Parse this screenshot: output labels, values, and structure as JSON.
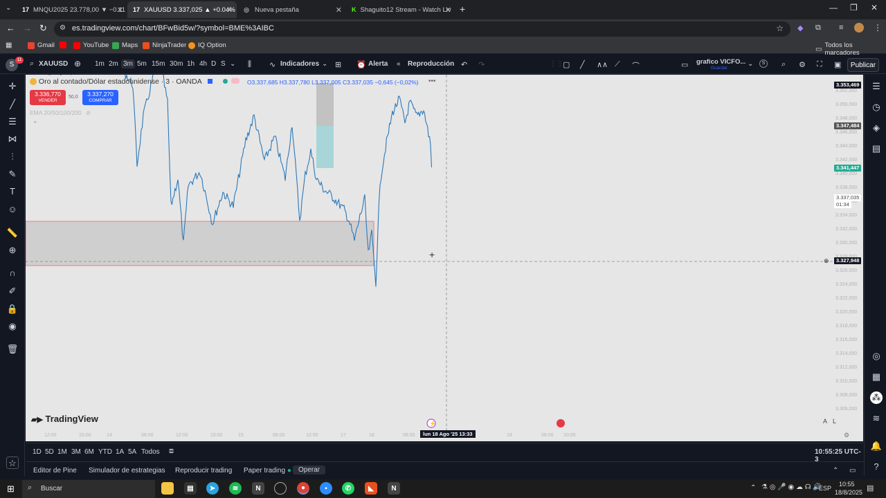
{
  "browser": {
    "tabs": [
      {
        "title": "MNQU2025 23.778,00 ▼ −0.11",
        "active": false
      },
      {
        "title": "XAUUSD 3.337,025 ▲ +0.04% ·",
        "active": true
      },
      {
        "title": "Nueva pestaña",
        "active": false
      },
      {
        "title": "Shaguito12 Stream - Watch Liv",
        "active": false
      }
    ],
    "url": "es.tradingview.com/chart/BFwBid5w/?symbol=BME%3AIBC",
    "bookmarks": [
      "Gmail",
      "YouTube",
      "Maps",
      "NinjaTrader",
      "IQ Option"
    ],
    "all_bookmarks": "Todos los marcadores"
  },
  "toolbar": {
    "avatar_letter": "S",
    "avatar_badge": "11",
    "symbol": "XAUUSD",
    "intervals": [
      "1m",
      "2m",
      "3m",
      "5m",
      "15m",
      "30m",
      "1h",
      "4h",
      "D",
      "S"
    ],
    "selected_interval": "3m",
    "indicators": "Indicadores",
    "alert": "Alerta",
    "replay": "Reproducción",
    "layout_name": "grafico VICFO...",
    "layout_save": "Guardar",
    "layout_s": "S",
    "publish": "Publicar"
  },
  "chart": {
    "legend_title": "Oro al contado/Dólar estadounidense · 3 · OANDA",
    "ohlc": "O3.337,685 H3.337,780 L3.337,005 C3.337,035 −0,645 (−0,02%)",
    "sell_price": "3.336,770",
    "sell_label": "VENDER",
    "buy_price": "3.337,270",
    "buy_label": "COMPRAR",
    "spread": "50,0",
    "ema": "EMA 20/50/100/200",
    "logo": "TradingView",
    "price_labels": [
      "3.352,000",
      "3.350,000",
      "3.348,000",
      "3.346,000",
      "3.344,000",
      "3.342,000",
      "3.340,000",
      "3.338,000",
      "3.336,000",
      "3.334,000",
      "3.332,000",
      "3.330,000",
      "3.328,000",
      "3.326,000",
      "3.324,000",
      "3.322,000",
      "3.320,000",
      "3.318,000",
      "3.316,000",
      "3.314,000",
      "3.312,000",
      "3.310,000",
      "3.308,000",
      "3.306,000"
    ],
    "tag_high": "3.353,469",
    "tag_mid": "3.347,484",
    "tag_teal": "3.341,447",
    "tag_last": "3.337,035",
    "tag_countdown": "01:34",
    "tag_crosshair": "3.327,948",
    "time_labels": [
      "12:00",
      "15:00",
      "14",
      "06:00",
      "12:00",
      "15:00",
      "15",
      "06:00",
      "12:00",
      "17",
      "18",
      "06:00",
      "19",
      "06:00",
      "10:00"
    ],
    "crosshair_time": "lun 18 Ago '25   13:33",
    "axis_a": "A",
    "axis_l": "L"
  },
  "ranges": [
    "1D",
    "5D",
    "1M",
    "3M",
    "6M",
    "YTD",
    "1A",
    "5A",
    "Todos"
  ],
  "clock": "10:55:25 UTC-3",
  "panels": [
    "Editor de Pine",
    "Simulador de estrategias",
    "Reproducir trading",
    "Paper trading",
    "Operar"
  ],
  "taskbar": {
    "search": "Buscar",
    "lang": "ESP",
    "time": "10:55",
    "date": "18/8/2025"
  }
}
